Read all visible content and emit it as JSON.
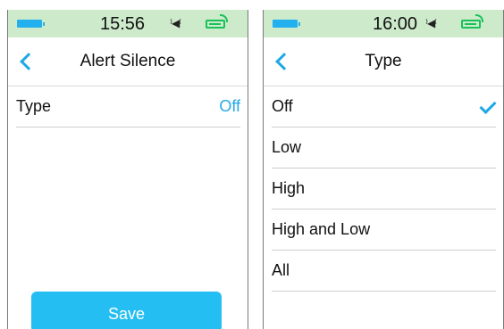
{
  "left_screen": {
    "status": {
      "time": "15:56"
    },
    "header": {
      "title": "Alert Silence"
    },
    "rows": [
      {
        "label": "Type",
        "value": "Off"
      }
    ],
    "save_label": "Save"
  },
  "right_screen": {
    "status": {
      "time": "16:00"
    },
    "header": {
      "title": "Type"
    },
    "options": [
      {
        "label": "Off",
        "selected": true
      },
      {
        "label": "Low",
        "selected": false
      },
      {
        "label": "High",
        "selected": false
      },
      {
        "label": "High and Low",
        "selected": false
      },
      {
        "label": "All",
        "selected": false
      }
    ]
  },
  "colors": {
    "accent": "#1fa8e6",
    "status_bar": "#cdeacb",
    "battery_green": "#18c15a",
    "save_button": "#25bef3"
  },
  "icons": [
    "battery-icon",
    "speaker-icon",
    "battery-signal-icon",
    "back-chevron-icon",
    "checkmark-icon"
  ]
}
